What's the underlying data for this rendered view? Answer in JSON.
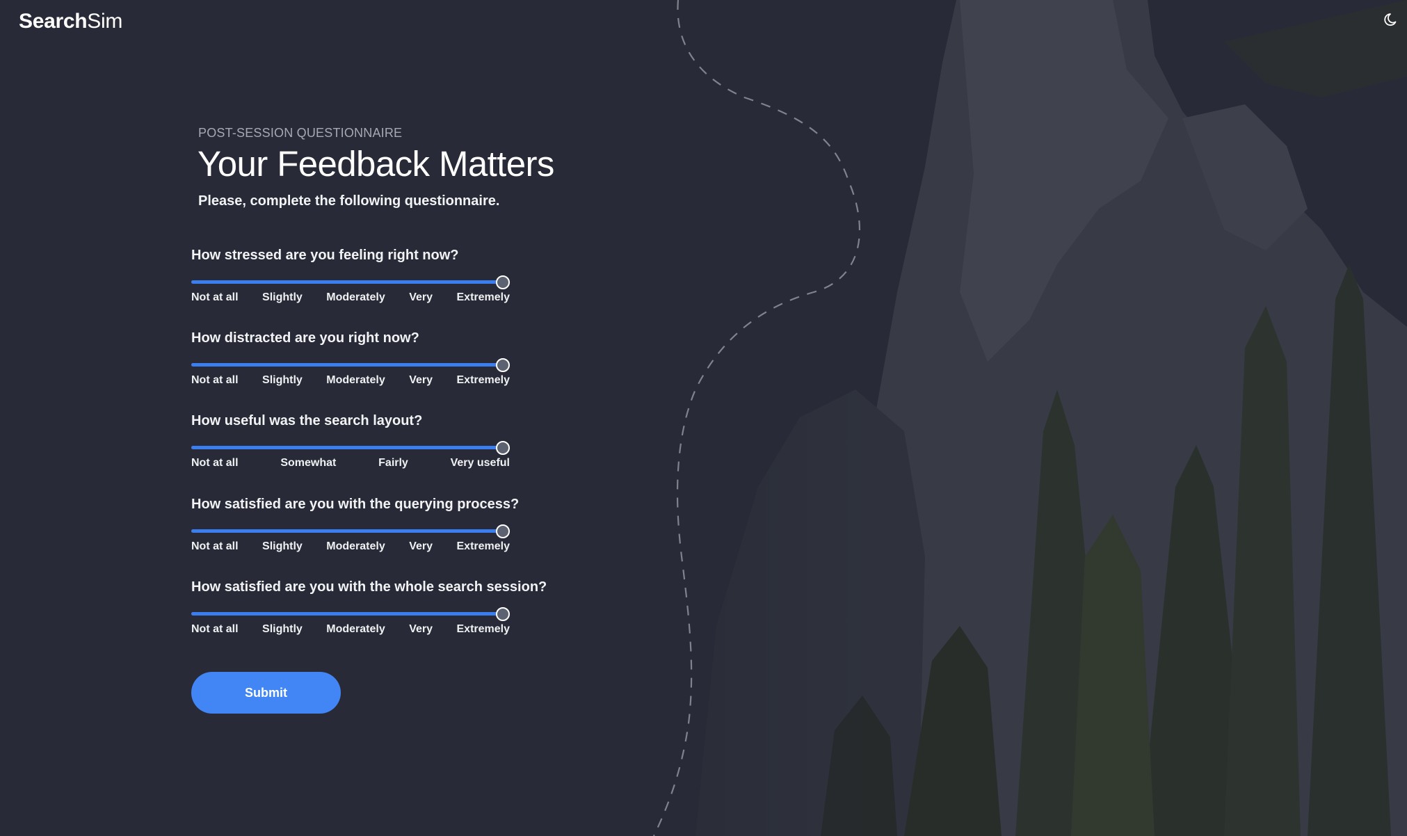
{
  "brand": {
    "name_bold": "Search",
    "name_regular": "Sim"
  },
  "header": {
    "theme_toggle_icon": "moon-icon"
  },
  "hero": {
    "eyebrow": "POST-SESSION QUESTIONNAIRE",
    "title": "Your Feedback Matters",
    "subtitle": "Please, complete the following questionnaire."
  },
  "questions": [
    {
      "label": "How stressed are you feeling right now?",
      "options": [
        "Not at all",
        "Slightly",
        "Moderately",
        "Very",
        "Extremely"
      ],
      "value_fraction": 1.0
    },
    {
      "label": "How distracted are you right now?",
      "options": [
        "Not at all",
        "Slightly",
        "Moderately",
        "Very",
        "Extremely"
      ],
      "value_fraction": 1.0
    },
    {
      "label": "How useful was the search layout?",
      "options": [
        "Not at all",
        "Somewhat",
        "Fairly",
        "Very useful"
      ],
      "value_fraction": 1.0
    },
    {
      "label": "How satisfied are you with the querying process?",
      "options": [
        "Not at all",
        "Slightly",
        "Moderately",
        "Very",
        "Extremely"
      ],
      "value_fraction": 1.0
    },
    {
      "label": "How satisfied are you with the whole search session?",
      "options": [
        "Not at all",
        "Slightly",
        "Moderately",
        "Very",
        "Extremely"
      ],
      "value_fraction": 1.0
    }
  ],
  "submit_label": "Submit",
  "colors": {
    "background": "#282b37",
    "accent": "#4285f4",
    "slider_fill": "#3b7ef0"
  }
}
